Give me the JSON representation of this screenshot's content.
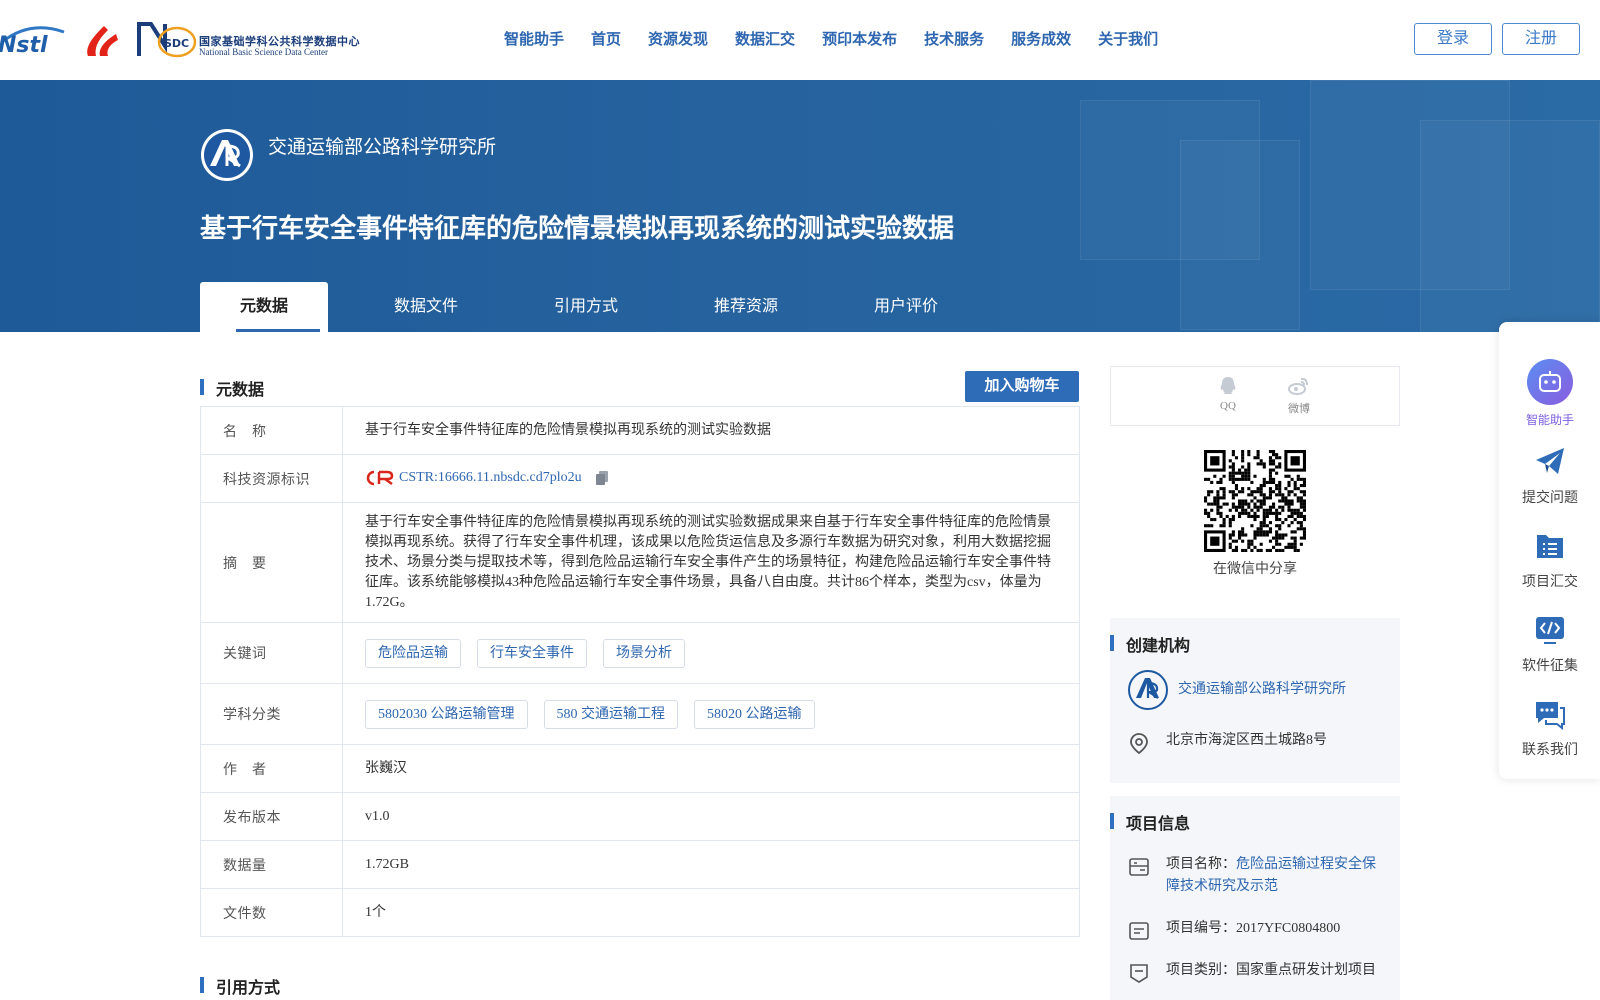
{
  "header": {
    "nav": [
      "智能助手",
      "首页",
      "资源发现",
      "数据汇交",
      "预印本发布",
      "技术服务",
      "服务成效",
      "关于我们"
    ],
    "login": "登录",
    "register": "注册",
    "logos": {
      "nstl_text": "Nstl",
      "nsdc_mark": "SDC",
      "nsdc_cn": "国家基础学科公共科学数据中心",
      "nsdc_en": "National Basic Science Data Center"
    }
  },
  "banner": {
    "institution": "交通运输部公路科学研究所",
    "title": "基于行车安全事件特征库的危险情景模拟再现系统的测试实验数据",
    "tabs": [
      "元数据",
      "数据文件",
      "引用方式",
      "推荐资源",
      "用户评价"
    ],
    "active_tab": 0
  },
  "metadata": {
    "heading": "元数据",
    "add_cart": "加入购物车",
    "labels": {
      "name": "名　称",
      "identifier": "科技资源标识",
      "abstract": "摘　要",
      "keywords": "关键词",
      "subject": "学科分类",
      "author": "作　者",
      "version": "发布版本",
      "size": "数据量",
      "files": "文件数"
    },
    "name": "基于行车安全事件特征库的危险情景模拟再现系统的测试实验数据",
    "cstr": "CSTR:16666.11.nbsdc.cd7plo2u",
    "abstract": "基于行车安全事件特征库的危险情景模拟再现系统的测试实验数据成果来自基于行车安全事件特征库的危险情景模拟再现系统。获得了行车安全事件机理，该成果以危险货运信息及多源行车数据为研究对象，利用大数据挖掘技术、场景分类与提取技术等，得到危险品运输行车安全事件产生的场景特征，构建危险品运输行车安全事件特征库。该系统能够模拟43种危险品运输行车安全事件场景，具备八自由度。共计86个样本，类型为csv，体量为1.72G。",
    "keywords": [
      "危险品运输",
      "行车安全事件",
      "场景分析"
    ],
    "subjects": [
      "5802030 公路运输管理",
      "580 交通运输工程",
      "58020 公路运输"
    ],
    "author": "张巍汉",
    "version": "v1.0",
    "size": "1.72GB",
    "files": "1个"
  },
  "citation": {
    "heading": "引用方式"
  },
  "share": {
    "qq": "QQ",
    "weibo": "微博",
    "wechat_caption": "在微信中分享"
  },
  "creator": {
    "heading": "创建机构",
    "name": "交通运输部公路科学研究所",
    "address": "北京市海淀区西土城路8号"
  },
  "project": {
    "heading": "项目信息",
    "name_label": "项目名称：",
    "name": "危险品运输过程安全保障技术研究及示范",
    "code": "项目编号：2017YFC0804800",
    "category": "项目类别：国家重点研发计划项目"
  },
  "floatbar": {
    "items": [
      "智能助手",
      "提交问题",
      "项目汇交",
      "软件征集",
      "联系我们"
    ]
  },
  "colors": {
    "brand_blue": "#2e67b0",
    "banner_blue": "#1e5a97",
    "button_blue": "#2e6cb8",
    "assistant_purple": "#7b5ce0"
  }
}
